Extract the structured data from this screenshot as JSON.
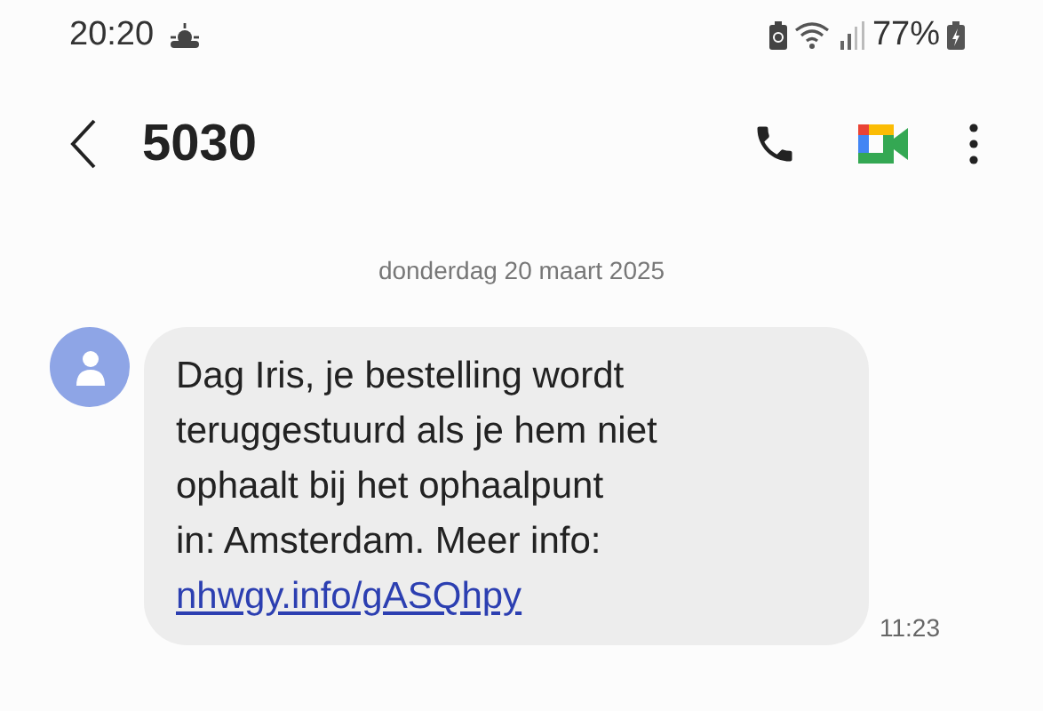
{
  "status_bar": {
    "time": "20:20",
    "battery": "77%"
  },
  "header": {
    "title": "5030"
  },
  "conversation": {
    "date": "donderdag 20 maart 2025",
    "messages": [
      {
        "lines": [
          "Dag Iris, je bestelling wordt",
          "teruggestuurd als je hem niet",
          "ophaalt bij het ophaalpunt",
          "in: Amsterdam. Meer info:"
        ],
        "link": "nhwgy.info/gASQhpy",
        "time": "11:23"
      }
    ]
  }
}
